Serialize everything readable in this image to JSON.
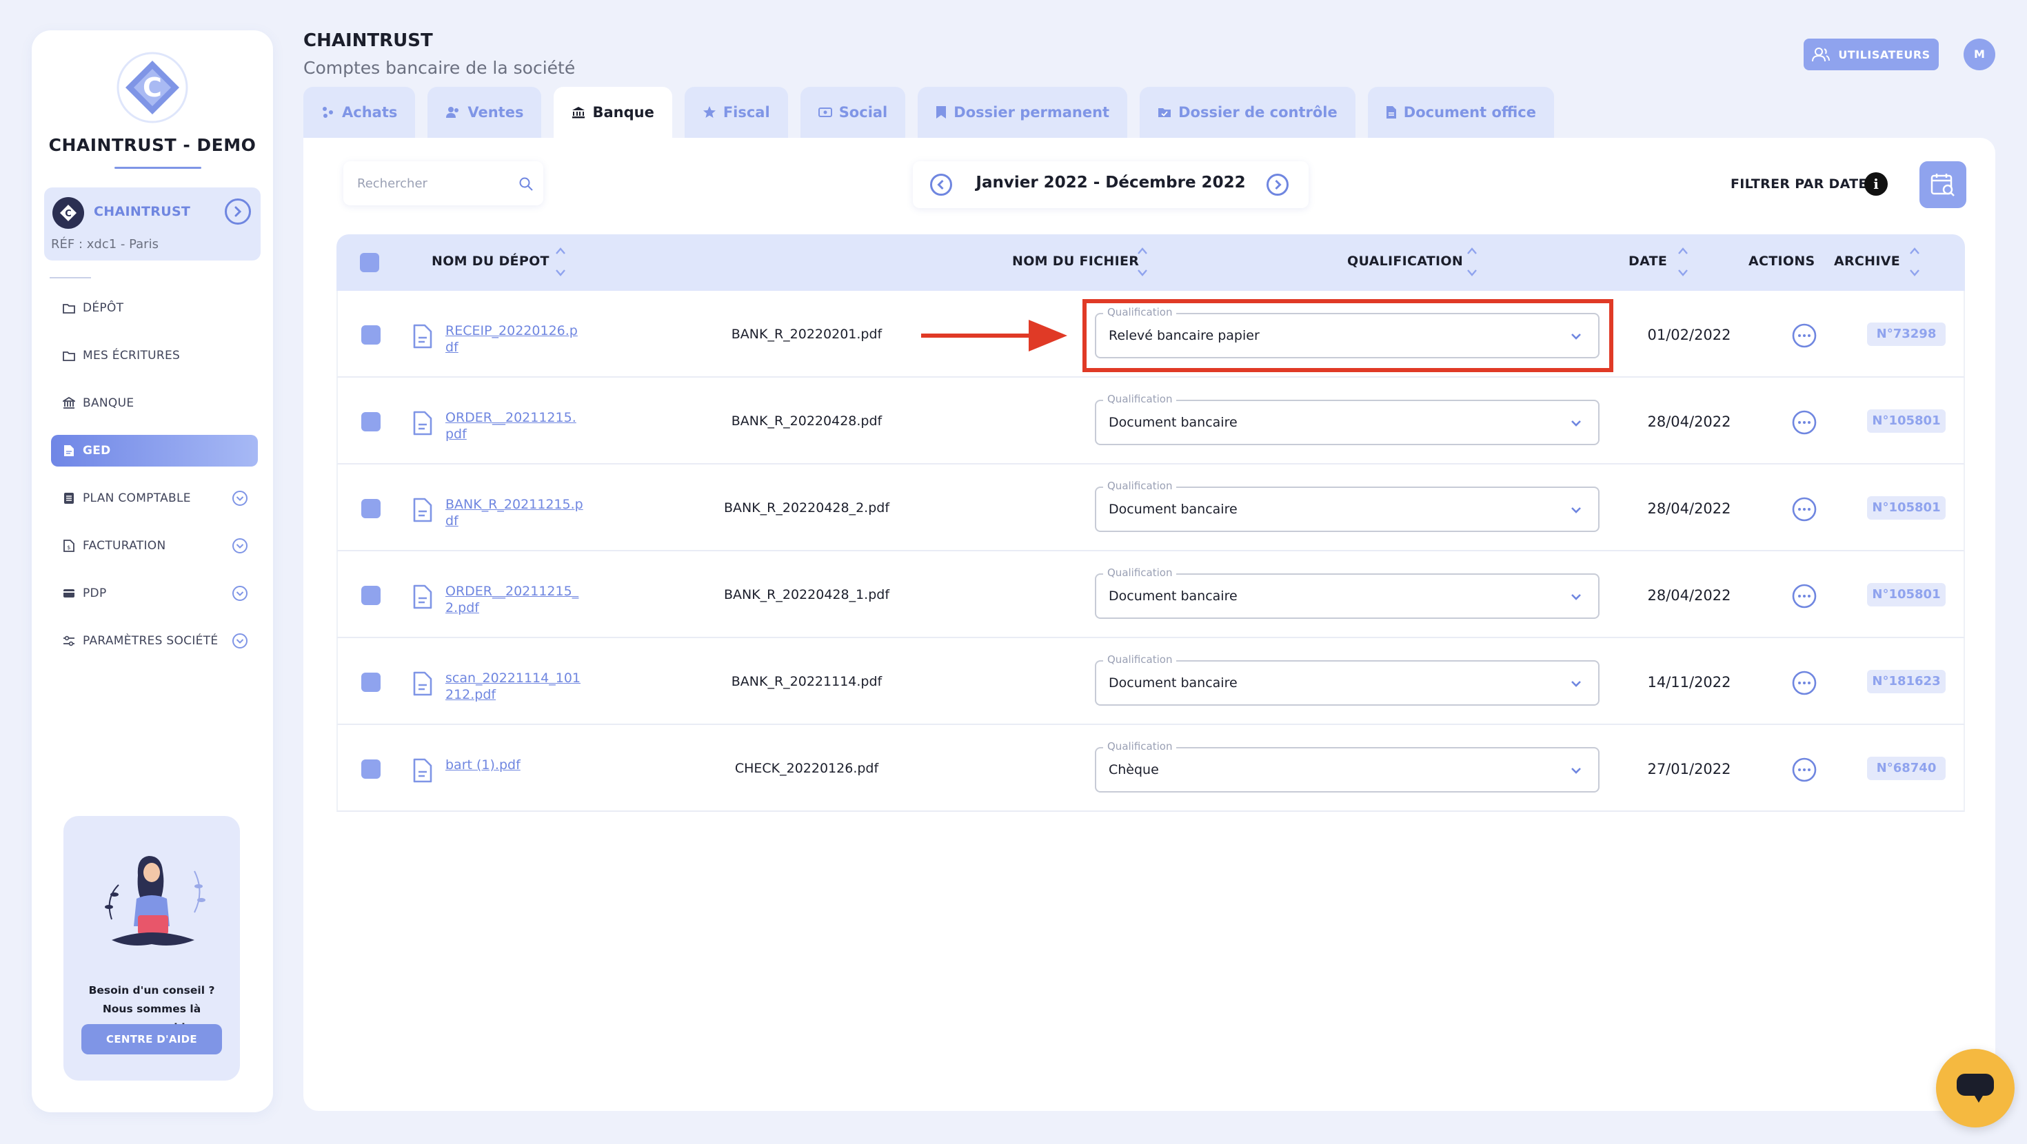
{
  "sidebar": {
    "company_name": "CHAINTRUST - DEMO",
    "company_card": {
      "name": "CHAINTRUST",
      "ref": "RÉF : xdc1 - Paris"
    },
    "items": [
      {
        "label": "DÉPÔT",
        "icon": "folder-icon",
        "active": false,
        "expandable": false
      },
      {
        "label": "MES ÉCRITURES",
        "icon": "folder-icon",
        "active": false,
        "expandable": false
      },
      {
        "label": "BANQUE",
        "icon": "bank-icon",
        "active": false,
        "expandable": false
      },
      {
        "label": "GED",
        "icon": "document-icon",
        "active": true,
        "expandable": false
      },
      {
        "label": "PLAN COMPTABLE",
        "icon": "ledger-icon",
        "active": false,
        "expandable": true
      },
      {
        "label": "FACTURATION",
        "icon": "invoice-icon",
        "active": false,
        "expandable": true
      },
      {
        "label": "PDP",
        "icon": "card-icon",
        "active": false,
        "expandable": true
      },
      {
        "label": "PARAMÈTRES SOCIÉTÉ",
        "icon": "sliders-icon",
        "active": false,
        "expandable": true
      }
    ],
    "help": {
      "line1": "Besoin d'un conseil ?",
      "line2": "Nous sommes là",
      "line3": "pour vous aider.",
      "button": "CENTRE D'AIDE"
    }
  },
  "header": {
    "title": "CHAINTRUST",
    "subtitle": "Comptes bancaire de la société",
    "users_button": "UTILISATEURS",
    "avatar_initial": "M"
  },
  "tabs": [
    {
      "label": "Achats",
      "icon": "cart-icon",
      "active": false
    },
    {
      "label": "Ventes",
      "icon": "users-icon",
      "active": false
    },
    {
      "label": "Banque",
      "icon": "bank-icon",
      "active": true
    },
    {
      "label": "Fiscal",
      "icon": "star-icon",
      "active": false
    },
    {
      "label": "Social",
      "icon": "id-card-icon",
      "active": false
    },
    {
      "label": "Dossier permanent",
      "icon": "bookmark-icon",
      "active": false
    },
    {
      "label": "Dossier de contrôle",
      "icon": "folder-check-icon",
      "active": false
    },
    {
      "label": "Document office",
      "icon": "file-icon",
      "active": false
    }
  ],
  "toolbar": {
    "search_placeholder": "Rechercher",
    "period": "Janvier 2022 - Décembre 2022",
    "filter_label": "FILTRER PAR DATE",
    "info": "i"
  },
  "table": {
    "headers": {
      "deposit": "NOM DU DÉPOT",
      "file": "NOM DU FICHIER",
      "qualification": "QUALIFICATION",
      "date": "DATE",
      "actions": "ACTIONS",
      "archive": "ARCHIVE"
    },
    "qualification_label": "Qualification",
    "rows": [
      {
        "deposit": "RECEIP_20220126.pdf",
        "file": "BANK_R_20220201.pdf",
        "qualification": "Relevé bancaire papier",
        "date": "01/02/2022",
        "archive": "N°73298",
        "highlighted": true
      },
      {
        "deposit": "ORDER__20211215.pdf",
        "file": "BANK_R_20220428.pdf",
        "qualification": "Document bancaire",
        "date": "28/04/2022",
        "archive": "N°105801",
        "highlighted": false
      },
      {
        "deposit": "BANK_R_20211215.pdf",
        "file": "BANK_R_20220428_2.pdf",
        "qualification": "Document bancaire",
        "date": "28/04/2022",
        "archive": "N°105801",
        "highlighted": false
      },
      {
        "deposit": "ORDER__20211215_2.pdf",
        "file": "BANK_R_20220428_1.pdf",
        "qualification": "Document bancaire",
        "date": "28/04/2022",
        "archive": "N°105801",
        "highlighted": false
      },
      {
        "deposit": "scan_20221114_101212.pdf",
        "file": "BANK_R_20221114.pdf",
        "qualification": "Document bancaire",
        "date": "14/11/2022",
        "archive": "N°181623",
        "highlighted": false
      },
      {
        "deposit": "bart (1).pdf",
        "file": "CHECK_20220126.pdf",
        "qualification": "Chèque",
        "date": "27/01/2022",
        "archive": "N°68740",
        "highlighted": false
      }
    ]
  },
  "colors": {
    "accent": "#7f95e6",
    "accent_light": "#dfe6fb",
    "highlight": "#e03a26",
    "chat": "#f5b940"
  }
}
